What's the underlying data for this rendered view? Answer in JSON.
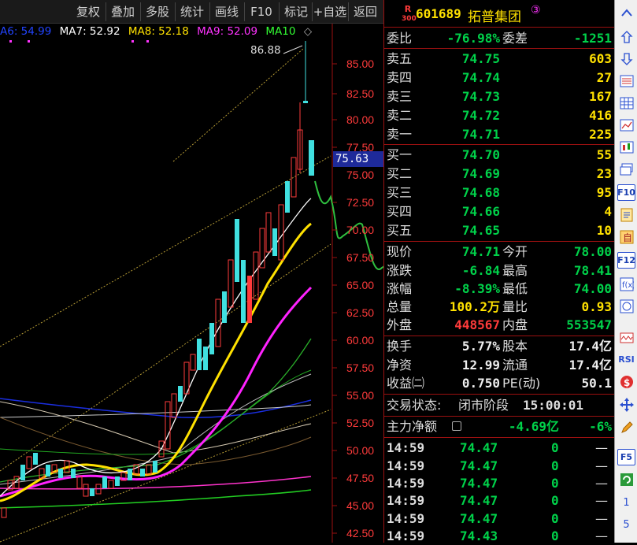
{
  "toolbar_top": {
    "buttons": [
      "复权",
      "叠加",
      "多股",
      "统计",
      "画线",
      "F10",
      "标记",
      "+自选",
      "返回"
    ]
  },
  "chart": {
    "ma_labels": [
      {
        "text": "A6: 54.99",
        "color": "#2244ff"
      },
      {
        "text": "MA7: 52.92",
        "color": "#ffffff"
      },
      {
        "text": "MA8: 52.18",
        "color": "#ffe100"
      },
      {
        "text": "MA9: 52.09",
        "color": "#ff33ff"
      },
      {
        "text": "MA10",
        "color": "#33ff33"
      }
    ],
    "price_axis": [
      "85.00",
      "82.50",
      "80.00",
      "77.50",
      "75.00",
      "72.50",
      "70.00",
      "67.50",
      "65.00",
      "62.50",
      "60.00",
      "57.50",
      "55.00",
      "52.50",
      "50.00",
      "47.50",
      "45.00",
      "42.50"
    ],
    "high_label": "86.88",
    "current_price_label": "75.63"
  },
  "quote": {
    "market_badge": "R",
    "market_sub": "300",
    "code": "601689",
    "name": "拓普集团",
    "circle_num": "③",
    "weibi_label": "委比",
    "weibi": "-76.98%",
    "weicha_label": "委差",
    "weicha": "-1251",
    "asks": [
      {
        "label": "卖五",
        "price": "74.75",
        "vol": "603"
      },
      {
        "label": "卖四",
        "price": "74.74",
        "vol": "27"
      },
      {
        "label": "卖三",
        "price": "74.73",
        "vol": "167"
      },
      {
        "label": "卖二",
        "price": "74.72",
        "vol": "416"
      },
      {
        "label": "卖一",
        "price": "74.71",
        "vol": "225"
      }
    ],
    "bids": [
      {
        "label": "买一",
        "price": "74.70",
        "vol": "55"
      },
      {
        "label": "买二",
        "price": "74.69",
        "vol": "23"
      },
      {
        "label": "买三",
        "price": "74.68",
        "vol": "95"
      },
      {
        "label": "买四",
        "price": "74.66",
        "vol": "4"
      },
      {
        "label": "买五",
        "price": "74.65",
        "vol": "10"
      }
    ],
    "stats": [
      {
        "l1": "现价",
        "v1": "74.71",
        "c1": "g",
        "l2": "今开",
        "v2": "78.00",
        "c2": "g"
      },
      {
        "l1": "涨跌",
        "v1": "-6.84",
        "c1": "g",
        "l2": "最高",
        "v2": "78.41",
        "c2": "g"
      },
      {
        "l1": "涨幅",
        "v1": "-8.39%",
        "c1": "g",
        "l2": "最低",
        "v2": "74.00",
        "c2": "g"
      },
      {
        "l1": "总量",
        "v1": "100.2万",
        "c1": "y",
        "l2": "量比",
        "v2": "0.93",
        "c2": "y"
      },
      {
        "l1": "外盘",
        "v1": "448567",
        "c1": "r",
        "l2": "内盘",
        "v2": "553547",
        "c2": "g"
      }
    ],
    "stats2": [
      {
        "l1": "换手",
        "v1": "5.77%",
        "l2": "股本",
        "v2": "17.4亿"
      },
      {
        "l1": "净资",
        "v1": "12.99",
        "l2": "流通",
        "v2": "17.4亿"
      },
      {
        "l1": "收益㈡",
        "v1": "0.750",
        "l2": "PE(动)",
        "v2": "50.1"
      }
    ],
    "status_label": "交易状态:",
    "status_value": "闭市阶段",
    "status_time": "15:00:01",
    "main_flow_label": "主力净额",
    "main_flow_value": "-4.69亿",
    "main_flow_pct": "-6%"
  },
  "ticks": [
    {
      "time": "14:59",
      "price": "74.47",
      "vol": "0",
      "dir": "—"
    },
    {
      "time": "14:59",
      "price": "74.47",
      "vol": "0",
      "dir": "—"
    },
    {
      "time": "14:59",
      "price": "74.47",
      "vol": "0",
      "dir": "—"
    },
    {
      "time": "14:59",
      "price": "74.47",
      "vol": "0",
      "dir": "—"
    },
    {
      "time": "14:59",
      "price": "74.47",
      "vol": "0",
      "dir": "—"
    },
    {
      "time": "14:59",
      "price": "74.43",
      "vol": "0",
      "dir": "—"
    }
  ],
  "side_tools": {
    "labels": [
      "F10",
      "F12",
      "RSI",
      "F5",
      "1",
      "5"
    ],
    "icons": [
      "scroll-up-icon",
      "up-arrow-icon",
      "down-arrow-icon",
      "table-icon",
      "grid-icon",
      "line-chart-icon",
      "candle-icon",
      "layers-icon",
      "f10-icon",
      "doc-icon",
      "zixuan-icon",
      "f12-icon",
      "function-icon",
      "radar-icon",
      "wave-icon",
      "rsi-icon",
      "money-icon",
      "move-icon",
      "pen-icon",
      "f5-icon",
      "refresh-icon",
      "one-icon",
      "five-icon"
    ]
  }
}
